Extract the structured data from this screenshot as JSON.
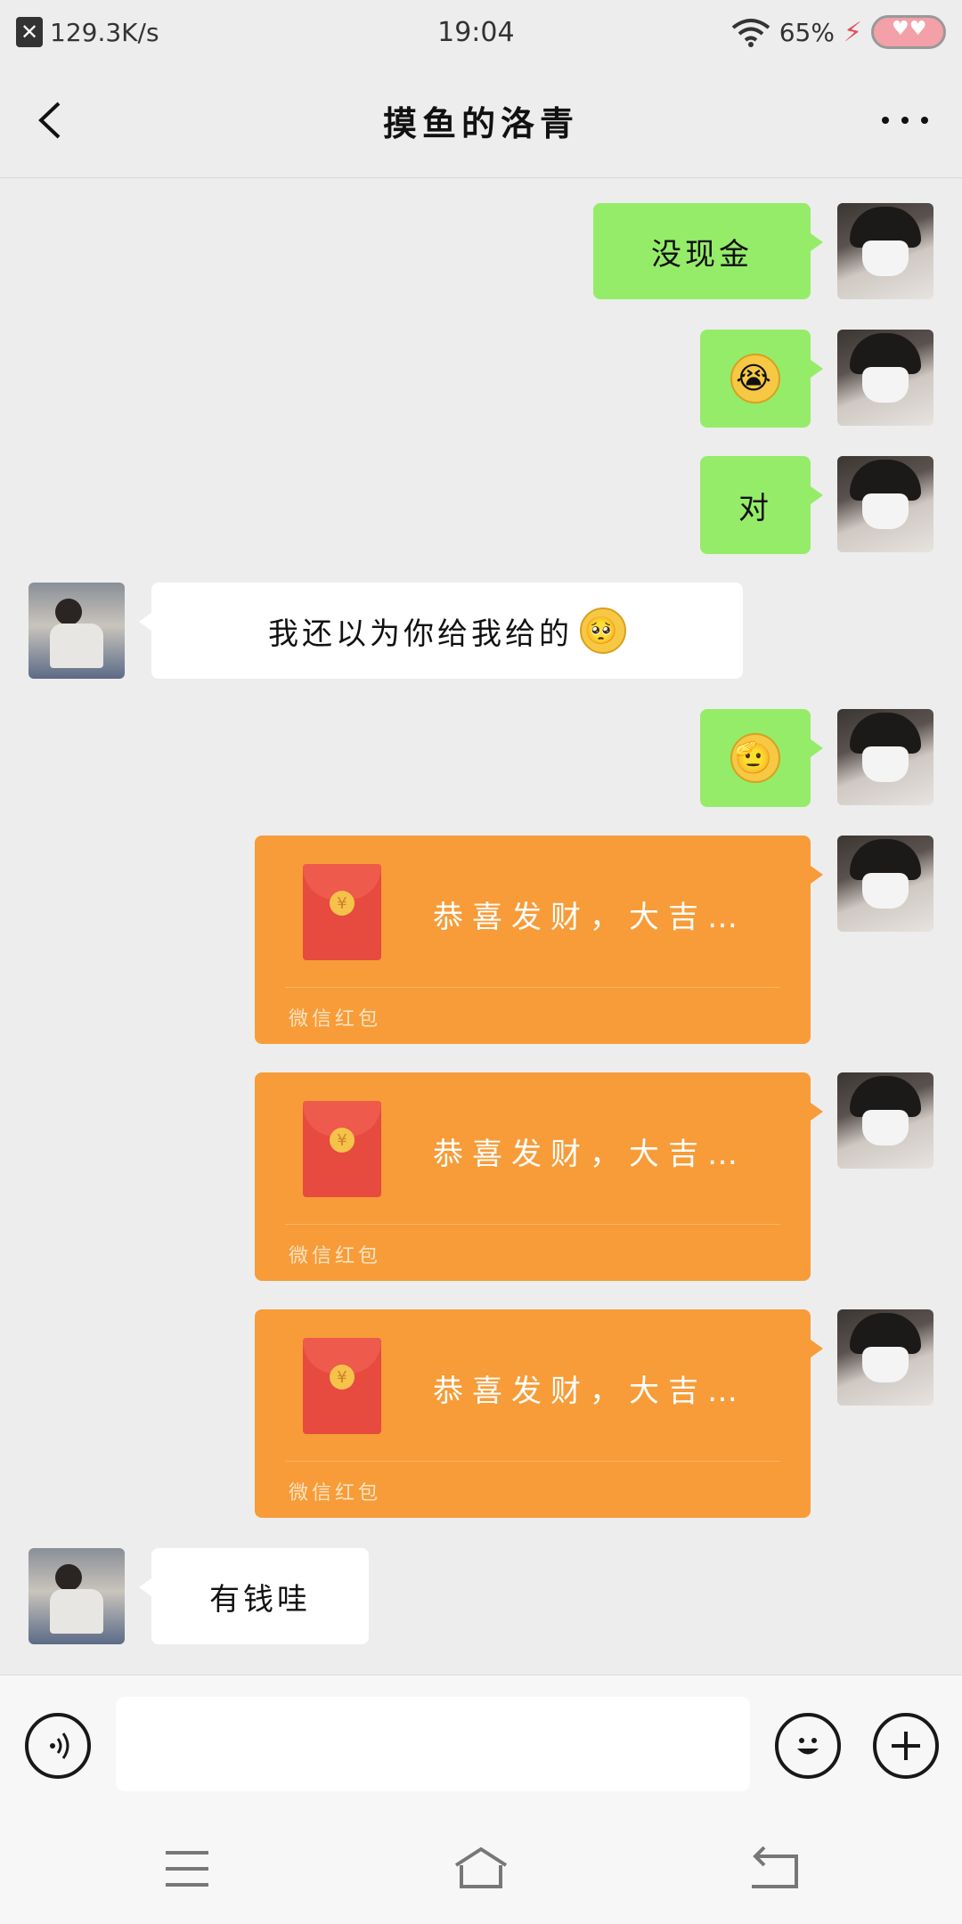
{
  "status_bar": {
    "network_speed": "129.3K/s",
    "time": "19:04",
    "battery": "65%"
  },
  "header": {
    "title": "摸鱼的洛青"
  },
  "messages": [
    {
      "from": "me",
      "type": "text",
      "text": "没现金"
    },
    {
      "from": "me",
      "type": "emoji",
      "emoji": "crying-face"
    },
    {
      "from": "me",
      "type": "text",
      "text": "对"
    },
    {
      "from": "other",
      "type": "text",
      "text": "我还以为你给我给的",
      "emoji": "pleading-face"
    },
    {
      "from": "me",
      "type": "emoji",
      "emoji": "salute-face"
    },
    {
      "from": "me",
      "type": "red_packet",
      "text": "恭喜发财，大吉…",
      "footer": "微信红包"
    },
    {
      "from": "me",
      "type": "red_packet",
      "text": "恭喜发财，大吉…",
      "footer": "微信红包"
    },
    {
      "from": "me",
      "type": "red_packet",
      "text": "恭喜发财，大吉…",
      "footer": "微信红包"
    },
    {
      "from": "other",
      "type": "text",
      "text": "有钱哇"
    }
  ],
  "input": {
    "placeholder": ""
  },
  "icons": {
    "back": "back-chevron-icon",
    "more": "more-dots-icon",
    "voice": "voice-icon",
    "emoji": "emoji-icon",
    "plus": "plus-icon",
    "coin": "¥"
  },
  "colors": {
    "background": "#ededed",
    "sent_bubble": "#95ec69",
    "received_bubble": "#ffffff",
    "red_packet": "#f79c38"
  }
}
